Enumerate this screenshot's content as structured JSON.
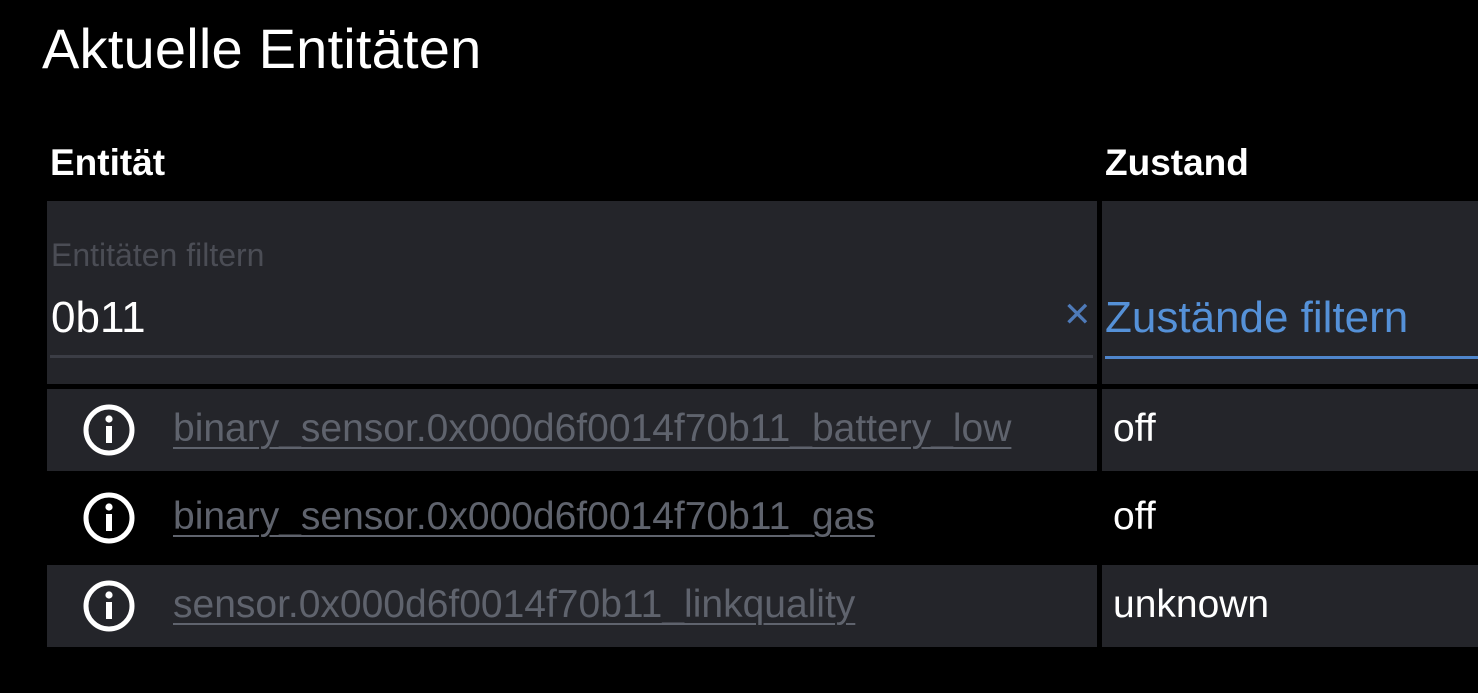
{
  "page": {
    "title": "Aktuelle Entitäten"
  },
  "table": {
    "headers": {
      "entity": "Entität",
      "state": "Zustand"
    },
    "entity_filter": {
      "label": "Entitäten filtern",
      "value": "0b11",
      "clear_icon": "close-icon"
    },
    "state_filter": {
      "placeholder": "Zustände filtern"
    },
    "rows": [
      {
        "entity": "binary_sensor.0x000d6f0014f70b11_battery_low",
        "state": "off",
        "icon": "info-icon"
      },
      {
        "entity": "binary_sensor.0x000d6f0014f70b11_gas",
        "state": "off",
        "icon": "info-icon"
      },
      {
        "entity": "sensor.0x000d6f0014f70b11_linkquality",
        "state": "unknown",
        "icon": "info-icon"
      }
    ]
  },
  "colors": {
    "background": "#000000",
    "row_band": "#24252a",
    "link_text": "#5f636d",
    "accent": "#5591d8",
    "clear_icon": "#4e7ab8"
  }
}
